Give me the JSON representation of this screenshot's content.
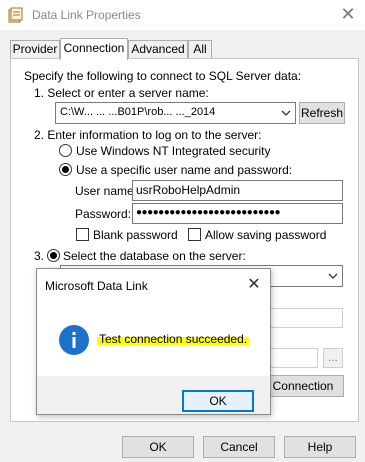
{
  "window": {
    "title": "Data Link Properties",
    "close_glyph": "✕"
  },
  "tabs": [
    {
      "label": "Provider"
    },
    {
      "label": "Connection"
    },
    {
      "label": "Advanced"
    },
    {
      "label": "All"
    }
  ],
  "connection": {
    "intro": "Specify the following to connect to SQL Server data:",
    "step1": "1. Select or enter a server name:",
    "server_value": "C:\\W... ...  ...B01P\\rob...  ..._2014",
    "refresh_label": "Refresh",
    "step2": "2. Enter information to log on to the server:",
    "nt_security": "Use Windows NT Integrated security",
    "specific_user": "Use a specific user name and password:",
    "username_label": "User name:",
    "username_value": "usrRoboHelpAdmin",
    "password_label": "Password:",
    "password_value": "●●●●●●●●●●●●●●●●●●●●●●●●●●",
    "blank_password": "Blank password",
    "allow_saving": "Allow saving password",
    "step3_prefix": "3.",
    "select_db": "Select the database on the server:",
    "test_connection_label": "Connection",
    "browse_label": "...",
    "radio_nt_selected": false,
    "radio_specific_selected": true,
    "radio_select_db_selected": true,
    "blank_password_checked": false,
    "allow_saving_checked": false
  },
  "dialog_buttons": {
    "ok": "OK",
    "cancel": "Cancel",
    "help": "Help"
  },
  "modal": {
    "title": "Microsoft Data Link",
    "close_glyph": "✕",
    "info_glyph": "i",
    "message": "Test connection succeeded.",
    "ok_label": "OK",
    "highlight_color": "#ffff00",
    "info_color": "#1a73c8"
  }
}
